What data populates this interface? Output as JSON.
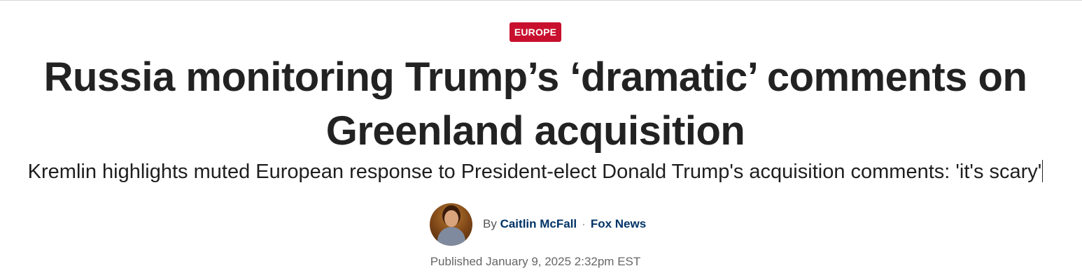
{
  "article": {
    "category": "EUROPE",
    "headline": "Russia monitoring Trump’s ‘dramatic’ comments on Greenland acquisition",
    "subheadline": "Kremlin highlights muted European response to President-elect Donald Trump's acquisition comments: 'it's scary'",
    "byline": {
      "prefix": "By",
      "author": "Caitlin McFall",
      "separator": "·",
      "publisher": "Fox News"
    },
    "published_label": "Published",
    "published_date": "January 9, 2025 2:32pm EST"
  },
  "colors": {
    "category_badge": "#c8102e",
    "author_link": "#003366",
    "headline": "#222222"
  }
}
